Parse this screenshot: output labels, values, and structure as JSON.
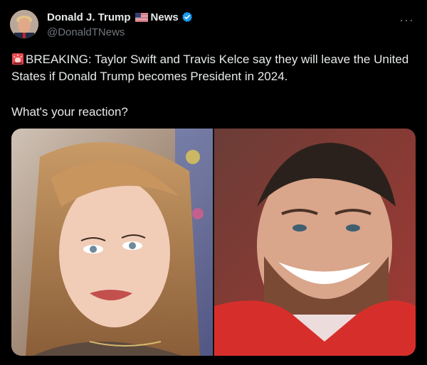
{
  "author": {
    "name": "Donald J. Trump",
    "suffix": "News",
    "handle": "@DonaldTNews"
  },
  "tweet": {
    "text": "BREAKING: Taylor Swift and Travis Kelce say they will leave the United States if Donald Trump becomes President in 2024.",
    "question": "What's your reaction?"
  },
  "icons": {
    "verified": "verified-badge-icon",
    "flag": "us-flag-icon",
    "siren": "siren-emoji-icon",
    "more": "more-options-icon"
  },
  "colors": {
    "background": "#000000",
    "text": "#e7e9ea",
    "secondary": "#71767b",
    "verified": "#1d9bf0"
  }
}
